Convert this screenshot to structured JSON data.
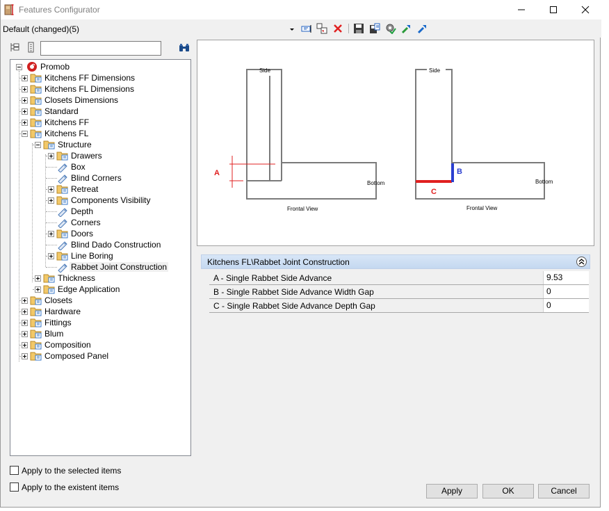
{
  "window": {
    "title": "Features Configurator"
  },
  "toolbar": {
    "preset_label": "Default (changed)(5)"
  },
  "tree": {
    "root": "Promob",
    "items": [
      "Kitchens FF Dimensions",
      "Kitchens FL Dimensions",
      "Closets Dimensions",
      "Standard",
      "Kitchens FF",
      "Kitchens FL",
      "Structure",
      "Drawers",
      "Box",
      "Blind Corners",
      "Retreat",
      "Components Visibility",
      "Depth",
      "Corners",
      "Doors",
      "Blind Dado Construction",
      "Line Boring",
      "Rabbet Joint Construction",
      "Thickness",
      "Edge Application",
      "Closets",
      "Hardware",
      "Fittings",
      "Blum",
      "Composition",
      "Composed Panel"
    ]
  },
  "diagram": {
    "left": {
      "side": "Side",
      "bottom": "Bottom",
      "view": "Frontal View",
      "marker": "A"
    },
    "right": {
      "side": "Side",
      "bottom": "Bottom",
      "view": "Frontal View",
      "marker_b": "B",
      "marker_c": "C"
    },
    "colors": {
      "red": "#e02020",
      "blue": "#2b3fd0",
      "line": "#7a7a7a"
    }
  },
  "properties": {
    "header": "Kitchens FL\\Rabbet Joint Construction",
    "rows": [
      {
        "name": "A - Single Rabbet Side Advance",
        "value": "9.53"
      },
      {
        "name": "B - Single Rabbet Side Advance Width Gap",
        "value": "0"
      },
      {
        "name": "C - Single Rabbet Side Advance Depth Gap",
        "value": "0"
      }
    ]
  },
  "options": {
    "apply_selected": "Apply to the selected items",
    "apply_existent": "Apply to the existent items"
  },
  "buttons": {
    "apply": "Apply",
    "ok": "OK",
    "cancel": "Cancel"
  }
}
